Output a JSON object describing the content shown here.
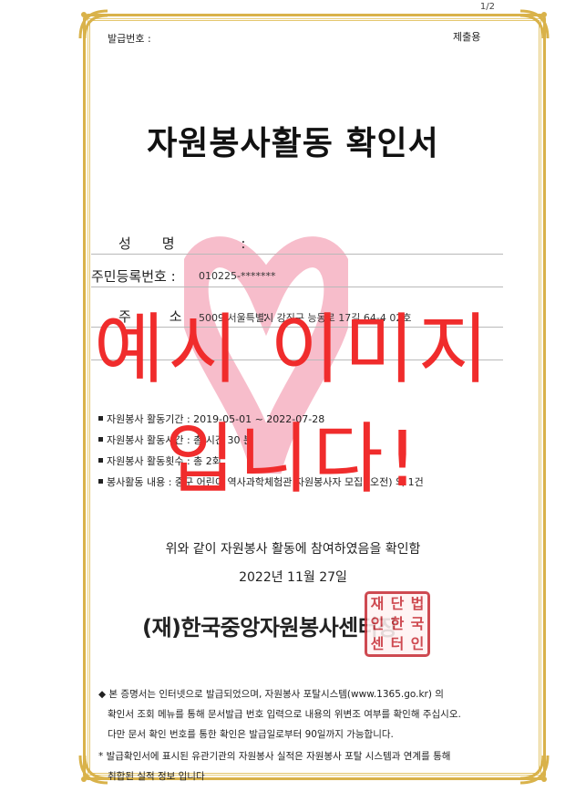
{
  "page_indicator": "1/2",
  "header": {
    "issue_number_label": "발급번호 :",
    "purpose": "제출용"
  },
  "title": "자원봉사활동 확인서",
  "fields": {
    "name_label": "성명 :",
    "name_value": "",
    "id_label": "주민등록번호 :",
    "id_value": "010225-*******",
    "address_label": "주소 :",
    "address_value": "5009 서울특별시 강진구 능동로 17길 64-4 02호"
  },
  "activities": [
    "자원봉사 활동기간 : 2019-05-01 ~ 2022-07-28",
    "자원봉사 활동시간 : 총 시간 30 분",
    "자원봉사 활동횟수 : 총 2회",
    "봉사활동 내용 : 중구 어린이 역사과학체험관 자원봉사자 모집 (오전) 외 1건"
  ],
  "confirmation": "위와 같이 자원봉사 활동에 참여하였음을 확인함",
  "date": "2022년 11월 27일",
  "issuer": "(재)한국중앙자원봉사센터장",
  "seal_chars": [
    "재",
    "단",
    "법",
    "인",
    "한",
    "국",
    "센",
    "터",
    "인"
  ],
  "notes": {
    "bullet_lines": [
      "◆ 본 증명서는 인터넷으로 발급되었으며, 자원봉사 포탈시스템(www.1365.go.kr) 의",
      "확인서 조회 메뉴를 통해 문서발급 번호 입력으로 내용의 위변조 여부를 확인해 주십시오.",
      "다만 문서 확인 번호를 통한 확인은 발급일로부터 90일까지 가능합니다."
    ],
    "star_lines": [
      "* 발급확인서에 표시된 유관기관의 자원봉사 실적은 자원봉사 포탈 시스템과 연계를 통해",
      "취합된 실적 정보 입니다"
    ]
  },
  "overlay": {
    "line1": "예시 이미지",
    "line2": "입니다!"
  },
  "colors": {
    "frame_gold": "#d9b24a",
    "overlay_red": "#f02c2c",
    "seal_red": "#c8323a",
    "watermark_pink": "#f4a7b9"
  }
}
